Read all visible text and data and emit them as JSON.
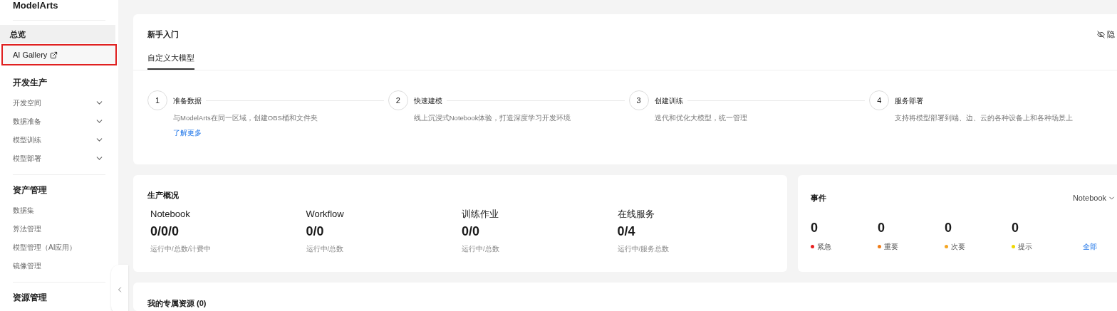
{
  "sidebar": {
    "title": "ModelArts",
    "top_items": [
      {
        "label": "总览",
        "selected": true,
        "highlighted": false,
        "external": false
      },
      {
        "label": "AI Gallery",
        "selected": false,
        "highlighted": true,
        "external": true
      }
    ],
    "sections": [
      {
        "title": "开发生产",
        "items": [
          {
            "label": "开发空间",
            "expandable": true
          },
          {
            "label": "数据准备",
            "expandable": true
          },
          {
            "label": "模型训练",
            "expandable": true
          },
          {
            "label": "模型部署",
            "expandable": true
          }
        ]
      },
      {
        "title": "资产管理",
        "items": [
          {
            "label": "数据集",
            "expandable": false
          },
          {
            "label": "算法管理",
            "expandable": false
          },
          {
            "label": "模型管理（AI应用）",
            "expandable": false
          },
          {
            "label": "镜像管理",
            "expandable": false
          }
        ]
      },
      {
        "title": "资源管理"
      }
    ]
  },
  "getting_started": {
    "title": "新手入门",
    "hide_label": "隐",
    "tabs": [
      {
        "label": "自定义大模型",
        "selected": true
      }
    ],
    "steps": [
      {
        "number": "1",
        "title": "准备数据",
        "description": "与ModelArts在同一区域，创建OBS桶和文件夹",
        "link": "了解更多"
      },
      {
        "number": "2",
        "title": "快速建模",
        "description": "线上沉浸式Notebook体验，打造深度学习开发环境"
      },
      {
        "number": "3",
        "title": "创建训练",
        "description": "迭代和优化大模型，统一管理"
      },
      {
        "number": "4",
        "title": "服务部署",
        "description": "支持将模型部署到端、边、云的各种设备上和各种场景上"
      }
    ]
  },
  "production": {
    "title": "生产概况",
    "stats": [
      {
        "name": "Notebook",
        "value": "0/0/0",
        "caption": "运行中/总数/计费中"
      },
      {
        "name": "Workflow",
        "value": "0/0",
        "caption": "运行中/总数"
      },
      {
        "name": "训练作业",
        "value": "0/0",
        "caption": "运行中/总数"
      },
      {
        "name": "在线服务",
        "value": "0/4",
        "caption": "运行中/服务总数"
      }
    ]
  },
  "events": {
    "title": "事件",
    "filter": "Notebook",
    "levels": [
      {
        "count": "0",
        "label": "紧急",
        "color": "#e82020"
      },
      {
        "count": "0",
        "label": "重要",
        "color": "#f07c18"
      },
      {
        "count": "0",
        "label": "次要",
        "color": "#f5a623"
      },
      {
        "count": "0",
        "label": "提示",
        "color": "#f0d800"
      }
    ],
    "all_link": "全部"
  },
  "resources": {
    "title": "我的专属资源 (0)"
  }
}
